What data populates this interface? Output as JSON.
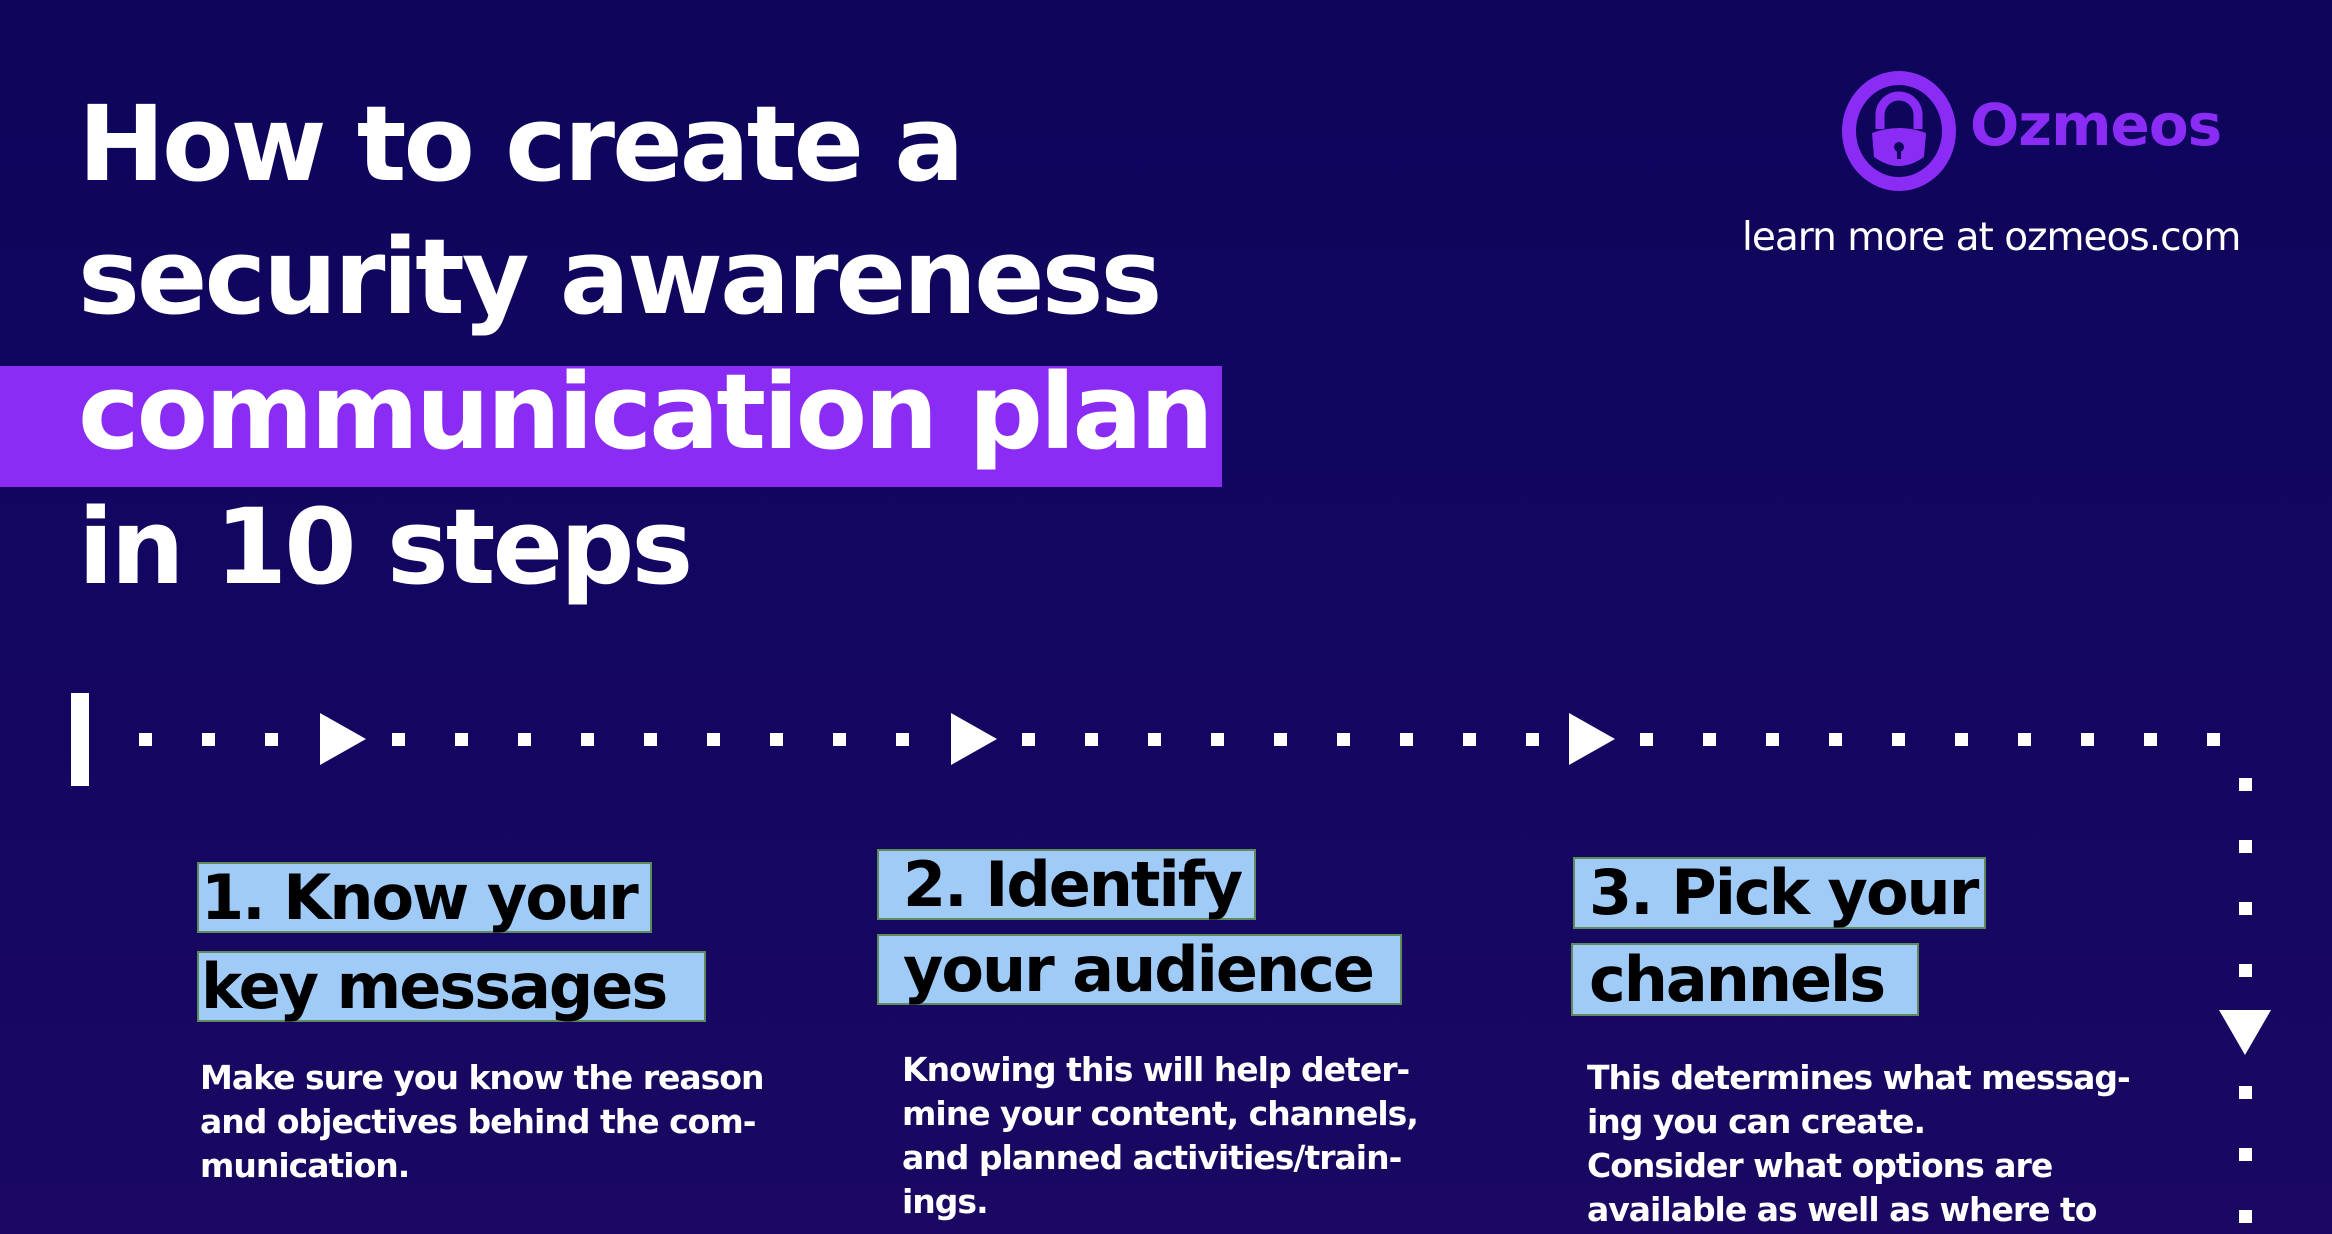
{
  "header": {
    "title_lines": [
      "How to create a",
      "security awareness",
      "communication plan",
      "in 10 steps"
    ],
    "highlighted_line_index": 2
  },
  "brand": {
    "logo_icon": "lock-in-circle-icon",
    "name": "Ozmeos",
    "tagline": "learn more at ozmeos.com",
    "accent_color": "#8b2cf5"
  },
  "timeline": {
    "icons": [
      "start-bar",
      "arrow-right-icon",
      "arrow-right-icon",
      "arrow-right-icon",
      "arrow-down-icon"
    ],
    "color": "#ffffff"
  },
  "steps": [
    {
      "heading_lines": [
        "1. Know your",
        "key messages"
      ],
      "body": "Make sure you know the reason\nand objectives behind the com-\nmunication."
    },
    {
      "heading_lines": [
        "2. Identify",
        "your audience"
      ],
      "body": "Knowing this will help deter-\nmine your content, channels,\nand planned activities/train-\nings."
    },
    {
      "heading_lines": [
        "3. Pick your",
        "channels"
      ],
      "body": "This determines what messag-\ning you can create.\nConsider what options are\navailable as well as where to"
    }
  ],
  "colors": {
    "background": "#0d065a",
    "highlight": "#8b2cf5",
    "step_heading_bg": "#a1cbf7",
    "text": "#ffffff"
  }
}
